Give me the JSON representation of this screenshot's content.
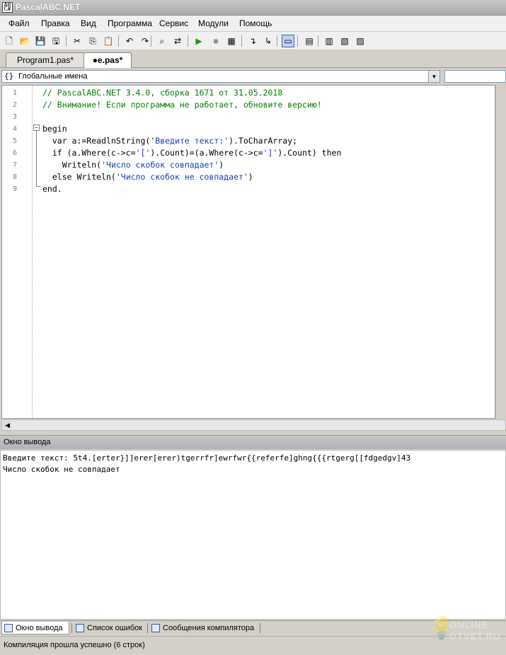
{
  "window": {
    "title": "PascalABC.NET",
    "icon_text": "AB\nC#"
  },
  "menu": [
    "Файл",
    "Правка",
    "Вид",
    "Программа",
    "Сервис",
    "Модули",
    "Помощь"
  ],
  "toolbar": {
    "icons": [
      "new-file-icon",
      "open-folder-icon",
      "save-icon",
      "save-all-icon",
      "cut-icon",
      "copy-icon",
      "paste-icon",
      "undo-icon",
      "redo-icon",
      "find-icon",
      "replace-icon",
      "run-icon",
      "stop-icon",
      "compile-icon",
      "step-into-icon",
      "step-over-icon",
      "output-window-icon",
      "format-icon",
      "debug-watch-icon",
      "debug-locals-icon",
      "debug-registers-icon"
    ],
    "glyphs": [
      "🗋",
      "📂",
      "💾",
      "🖫",
      "✂",
      "⎘",
      "📋",
      "↶",
      "↷",
      "⌕",
      "⇄",
      "▶",
      "■",
      "▦",
      "↴",
      "↳",
      "▭",
      "▤",
      "▥",
      "▧",
      "▨"
    ],
    "active_index": 16
  },
  "tabs": [
    {
      "label": "Program1.pas*",
      "active": false
    },
    {
      "label": "●e.pas*",
      "active": true
    }
  ],
  "namespace_combo": {
    "icon": "{}",
    "value": "Глобальные имена"
  },
  "editor": {
    "line_numbers": [
      "1",
      "2",
      "3",
      "4",
      "5",
      "6",
      "7",
      "8",
      "9"
    ],
    "lines": [
      [
        {
          "t": "// PascalABC.NET 3.4.0, сборка 1671 от 31.05.2018",
          "c": "comment"
        }
      ],
      [
        {
          "t": "// Внимание! Если программа не работает, обновите версию!",
          "c": "comment"
        }
      ],
      [
        {
          "t": "",
          "c": "kw"
        }
      ],
      [
        {
          "t": "begin",
          "c": "kw"
        }
      ],
      [
        {
          "t": "  var a:=ReadlnString(",
          "c": "kw"
        },
        {
          "t": "'Введите текст:'",
          "c": "str"
        },
        {
          "t": ").ToCharArray;",
          "c": "kw"
        }
      ],
      [
        {
          "t": "  if (a.Where(c->c=",
          "c": "kw"
        },
        {
          "t": "'['",
          "c": "str"
        },
        {
          "t": ").Count)=(a.Where(c->c=",
          "c": "kw"
        },
        {
          "t": "']'",
          "c": "str"
        },
        {
          "t": ").Count) then",
          "c": "kw"
        }
      ],
      [
        {
          "t": "    Writeln(",
          "c": "kw"
        },
        {
          "t": "'Число скобок совпадает'",
          "c": "str"
        },
        {
          "t": ")",
          "c": "kw"
        }
      ],
      [
        {
          "t": "  else Writeln(",
          "c": "kw"
        },
        {
          "t": "'Число скобок не совпадает'",
          "c": "str"
        },
        {
          "t": ")",
          "c": "kw"
        }
      ],
      [
        {
          "t": "end.",
          "c": "kw"
        }
      ]
    ]
  },
  "output": {
    "title": "Окно вывода",
    "lines": [
      "Введите текст: 5t4.[erter}]]erer[erer)tgerrfr]ewrfwr{{referfe]ghng{{{rtgerg[[fdgedgv]43",
      "Число скобок не совпадает"
    ]
  },
  "bottom_tabs": [
    {
      "label": "Окно вывода",
      "active": true
    },
    {
      "label": "Список ошибок",
      "active": false
    },
    {
      "label": "Сообщения компилятора",
      "active": false
    }
  ],
  "status": {
    "text": "Компиляция прошла успешно (6 строк)"
  },
  "watermark": {
    "line1": "ONLINE",
    "line2": "OTVET.RU"
  }
}
